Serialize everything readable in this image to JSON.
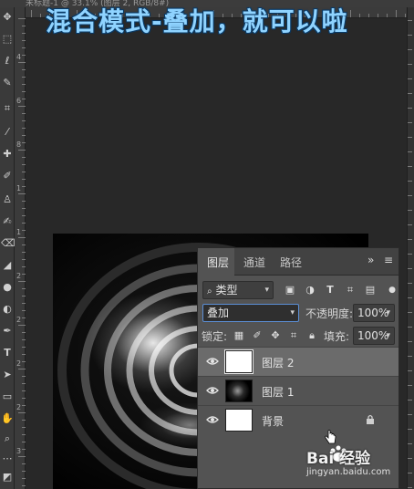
{
  "window": {
    "title": "未标题-1 @ 33.1% (图层 2, RGB/8#)"
  },
  "caption": "混合模式-叠加，就可以啦",
  "toolbar": {
    "tools": [
      "move-icon",
      "marquee-icon",
      "lasso-icon",
      "quick-select-icon",
      "crop-icon",
      "eyedropper-icon",
      "healing-brush-icon",
      "brush-icon",
      "clone-stamp-icon",
      "history-brush-icon",
      "eraser-icon",
      "gradient-icon",
      "blur-icon",
      "dodge-icon",
      "pen-icon",
      "type-icon",
      "path-select-icon",
      "rectangle-icon",
      "hand-icon",
      "zoom-icon",
      "more-tools-icon",
      "color-swatches-icon"
    ]
  },
  "ruler": {
    "v_labels": [
      "4",
      "6",
      "8",
      "1",
      "1",
      "2",
      "2",
      "2",
      "2",
      "3"
    ]
  },
  "layers_panel": {
    "tabs": [
      {
        "label": "图层"
      },
      {
        "label": "通道"
      },
      {
        "label": "路径"
      }
    ],
    "filter": {
      "kind_label": "类型"
    },
    "blend_mode": "叠加",
    "opacity_label": "不透明度:",
    "opacity_value": "100%",
    "lock_label": "锁定:",
    "fill_label": "填充:",
    "fill_value": "100%",
    "layers": [
      {
        "name": "图层 2",
        "selected": true,
        "thumb": "white"
      },
      {
        "name": "图层 1",
        "selected": false,
        "thumb": "dark-burst"
      },
      {
        "name": "背景",
        "selected": false,
        "thumb": "white",
        "locked": true
      }
    ]
  },
  "watermark": {
    "brand": "Bai 经验",
    "url": "jingyan.baidu.com"
  },
  "colors": {
    "accent": "#5b8fd6",
    "caption": "#8fd3ff",
    "panel_bg": "#535353",
    "app_bg": "#282828"
  }
}
